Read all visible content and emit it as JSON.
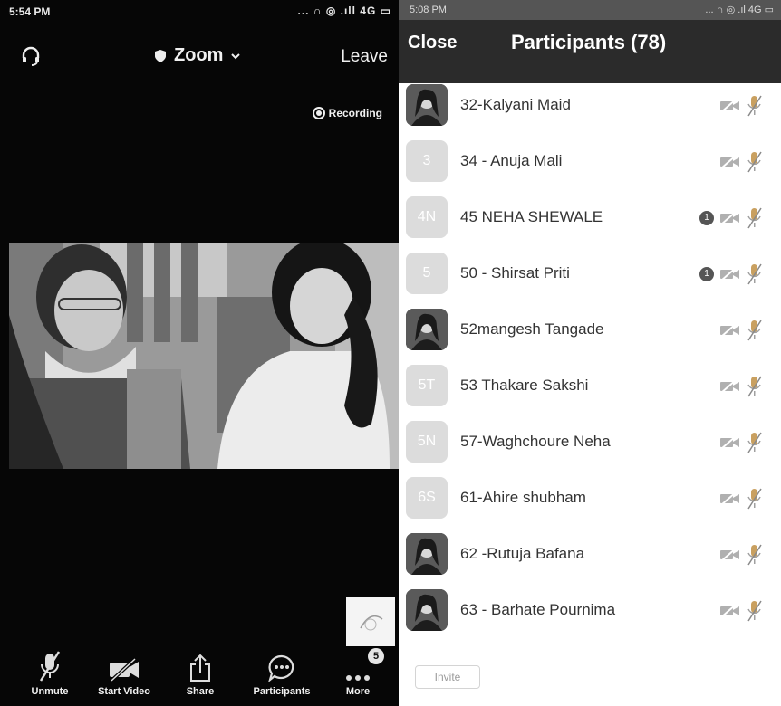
{
  "left": {
    "status_time": "5:54 PM",
    "status_icons": "... ∩ ◎ .ıll 4G ▭",
    "header": {
      "app_name": "Zoom",
      "leave": "Leave"
    },
    "recording": "Recording",
    "toolbar": [
      {
        "label": "Unmute",
        "icon": "mic-muted-icon"
      },
      {
        "label": "Start Video",
        "icon": "video-off-icon"
      },
      {
        "label": "Share",
        "icon": "share-icon"
      },
      {
        "label": "Participants",
        "icon": "chat-icon"
      },
      {
        "label": "More",
        "icon": "more-icon",
        "badge": "5"
      }
    ]
  },
  "right": {
    "status_time": "5:08 PM",
    "status_icons": "... ∩ ◎ .ıl 4G ▭",
    "close": "Close",
    "title": "Participants (78)",
    "participants": [
      {
        "name": "32-Kalyani Maid",
        "avatar": "",
        "photo": true,
        "badge": ""
      },
      {
        "name": "34 - Anuja Mali",
        "avatar": "3",
        "photo": false,
        "badge": ""
      },
      {
        "name": "45 NEHA SHEWALE",
        "avatar": "4N",
        "photo": false,
        "badge": "1"
      },
      {
        "name": "50 - Shirsat Priti",
        "avatar": "5",
        "photo": false,
        "badge": "1"
      },
      {
        "name": "52mangesh Tangade",
        "avatar": "",
        "photo": true,
        "badge": ""
      },
      {
        "name": "53 Thakare Sakshi",
        "avatar": "5T",
        "photo": false,
        "badge": ""
      },
      {
        "name": "57-Waghchoure Neha",
        "avatar": "5N",
        "photo": false,
        "badge": ""
      },
      {
        "name": "61-Ahire shubham",
        "avatar": "6S",
        "photo": false,
        "badge": ""
      },
      {
        "name": "62 -Rutuja Bafana",
        "avatar": "",
        "photo": true,
        "badge": ""
      },
      {
        "name": "63 - Barhate Pournima",
        "avatar": "",
        "photo": true,
        "badge": ""
      }
    ],
    "invite": "Invite"
  }
}
